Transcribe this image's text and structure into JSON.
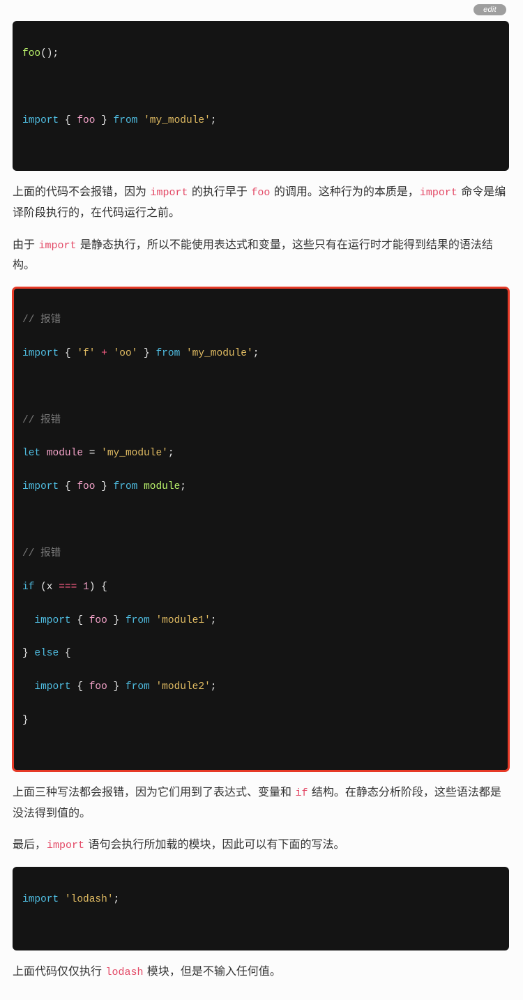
{
  "edit": {
    "label": "edit"
  },
  "block1": {
    "l1": {
      "a": "foo",
      "b": "();"
    },
    "l2": {
      "a": "import",
      "b": " { ",
      "c": "foo",
      "d": " } ",
      "e": "from",
      "f": " ",
      "g": "'my_module'",
      "h": ";"
    }
  },
  "para1": {
    "s1": "上面的代码不会报错，因为 ",
    "c1": "import",
    "s2": " 的执行早于 ",
    "c2": "foo",
    "s3": " 的调用。这种行为的本质是，",
    "c3": "import",
    "s4": " 命令是编译阶段执行的，在代码运行之前。"
  },
  "para2": {
    "s1": "由于 ",
    "c1": "import",
    "s2": " 是静态执行，所以不能使用表达式和变量，这些只有在运行时才能得到结果的语法结构。"
  },
  "block2": {
    "c1": "// 报错",
    "l1": {
      "a": "import",
      "b": " { ",
      "c": "'f'",
      "d": " ",
      "e": "+",
      "f": " ",
      "g": "'oo'",
      "h": " } ",
      "i": "from",
      "j": " ",
      "k": "'my_module'",
      "l": ";"
    },
    "c2": "// 报错",
    "l2": {
      "a": "let",
      "b": " ",
      "c": "module",
      "d": " = ",
      "e": "'my_module'",
      "f": ";"
    },
    "l3": {
      "a": "import",
      "b": " { ",
      "c": "foo",
      "d": " } ",
      "e": "from",
      "f": " ",
      "g": "module",
      "h": ";"
    },
    "c3": "// 报错",
    "l4": {
      "a": "if",
      "b": " (x ",
      "c": "===",
      "d": " ",
      "e": "1",
      "f": ") {"
    },
    "l5": {
      "a": "  ",
      "b": "import",
      "c": " { ",
      "d": "foo",
      "e": " } ",
      "f": "from",
      "g": " ",
      "h": "'module1'",
      "i": ";"
    },
    "l6": {
      "a": "} ",
      "b": "else",
      "c": " {"
    },
    "l7": {
      "a": "  ",
      "b": "import",
      "c": " { ",
      "d": "foo",
      "e": " } ",
      "f": "from",
      "g": " ",
      "h": "'module2'",
      "i": ";"
    },
    "l8": {
      "a": "}"
    }
  },
  "para3": {
    "s1": "上面三种写法都会报错，因为它们用到了表达式、变量和 ",
    "c1": "if",
    "s2": " 结构。在静态分析阶段，这些语法都是没法得到值的。"
  },
  "para4": {
    "s1": "最后，",
    "c1": "import",
    "s2": " 语句会执行所加载的模块，因此可以有下面的写法。"
  },
  "block3": {
    "l1": {
      "a": "import",
      "b": " ",
      "c": "'lodash'",
      "d": ";"
    }
  },
  "para5": {
    "s1": "上面代码仅仅执行 ",
    "c1": "lodash",
    "s2": " 模块，但是不输入任何值。"
  }
}
